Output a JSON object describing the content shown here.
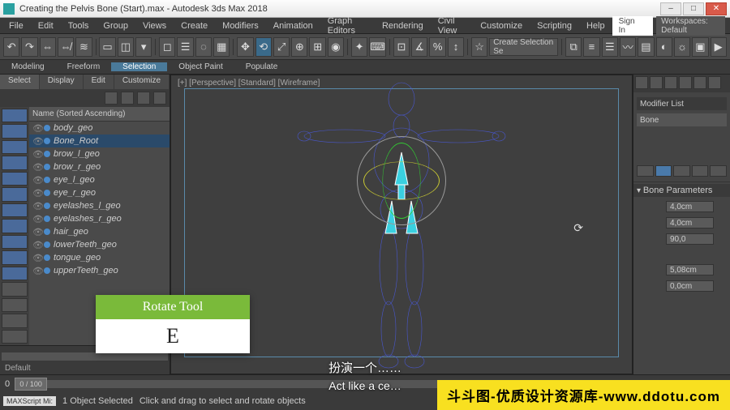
{
  "title": "Creating the Pelvis Bone (Start).max - Autodesk 3ds Max 2018",
  "menu": [
    "File",
    "Edit",
    "Tools",
    "Group",
    "Views",
    "Create",
    "Modifiers",
    "Animation",
    "Graph Editors",
    "Rendering",
    "Civil View",
    "Customize",
    "Scripting",
    "Help"
  ],
  "signin": "Sign In",
  "workspaces": "Workspaces: Default",
  "ribbon": [
    "Modeling",
    "Freeform",
    "Selection",
    "Object Paint",
    "Populate"
  ],
  "ribbon_active": 2,
  "selection_field": "Create Selection Se",
  "left": {
    "tabs": [
      "Select",
      "Display",
      "Edit",
      "Customize"
    ],
    "header": "Name (Sorted Ascending)",
    "items": [
      {
        "name": "body_geo",
        "sel": false
      },
      {
        "name": "Bone_Root",
        "sel": true
      },
      {
        "name": "brow_l_geo",
        "sel": false
      },
      {
        "name": "brow_r_geo",
        "sel": false
      },
      {
        "name": "eye_l_geo",
        "sel": false
      },
      {
        "name": "eye_r_geo",
        "sel": false
      },
      {
        "name": "eyelashes_l_geo",
        "sel": false
      },
      {
        "name": "eyelashes_r_geo",
        "sel": false
      },
      {
        "name": "hair_geo",
        "sel": false
      },
      {
        "name": "lowerTeeth_geo",
        "sel": false
      },
      {
        "name": "tongue_geo",
        "sel": false
      },
      {
        "name": "upperTeeth_geo",
        "sel": false
      }
    ],
    "layer": "Default"
  },
  "viewport": {
    "label": "[+] [Perspective] [Standard] [Wireframe]"
  },
  "right": {
    "modifier_label": "Modifier List",
    "stack_item": "Bone",
    "rollout": "Bone Parameters",
    "params": [
      "4,0cm",
      "4,0cm",
      "90,0",
      "5,08cm",
      "0,0cm"
    ]
  },
  "timeline": {
    "frame": "0 / 100",
    "left": "0",
    "right": "100"
  },
  "status": {
    "script": "MAXScript Mi:",
    "selected": "1 Object Selected",
    "hint": "Click and drag to select and rotate objects"
  },
  "tooltip": {
    "title": "Rotate Tool",
    "key": "E"
  },
  "subtitle_cn": "扮演一个……",
  "subtitle_en": "Act like a ce…",
  "watermark": "斗斗图-优质设计资源库-www.ddotu.com"
}
